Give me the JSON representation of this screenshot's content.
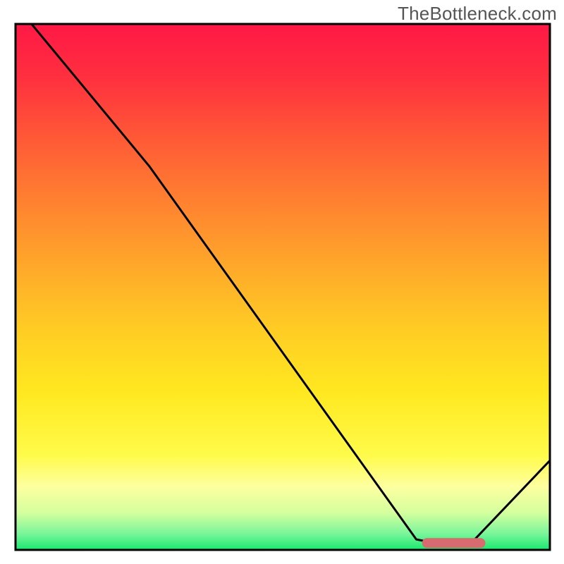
{
  "watermark": "TheBottleneck.com",
  "chart_data": {
    "type": "line",
    "title": "",
    "xlabel": "",
    "ylabel": "",
    "xlim": [
      0,
      100
    ],
    "ylim": [
      0,
      100
    ],
    "curve_points": [
      {
        "x": 3,
        "y": 100
      },
      {
        "x": 25,
        "y": 73
      },
      {
        "x": 75,
        "y": 2
      },
      {
        "x": 80,
        "y": 1
      },
      {
        "x": 85,
        "y": 1
      },
      {
        "x": 100,
        "y": 17
      }
    ],
    "marker_segment": {
      "x0": 77,
      "x1": 87,
      "y": 1.3
    },
    "gradient_stops": [
      {
        "offset": 0.0,
        "color": "#ff1846"
      },
      {
        "offset": 0.1,
        "color": "#ff2f3f"
      },
      {
        "offset": 0.22,
        "color": "#ff5a36"
      },
      {
        "offset": 0.34,
        "color": "#ff8230"
      },
      {
        "offset": 0.46,
        "color": "#ffa82a"
      },
      {
        "offset": 0.58,
        "color": "#ffcc24"
      },
      {
        "offset": 0.7,
        "color": "#ffe820"
      },
      {
        "offset": 0.82,
        "color": "#fffb4a"
      },
      {
        "offset": 0.88,
        "color": "#fdffa0"
      },
      {
        "offset": 0.93,
        "color": "#d4ff9e"
      },
      {
        "offset": 0.97,
        "color": "#77f59a"
      },
      {
        "offset": 1.0,
        "color": "#19e86f"
      }
    ],
    "marker_color": "#d86b6f",
    "curve_color": "#000000",
    "frame_color": "#000000",
    "background_outside": "#ffffff"
  }
}
